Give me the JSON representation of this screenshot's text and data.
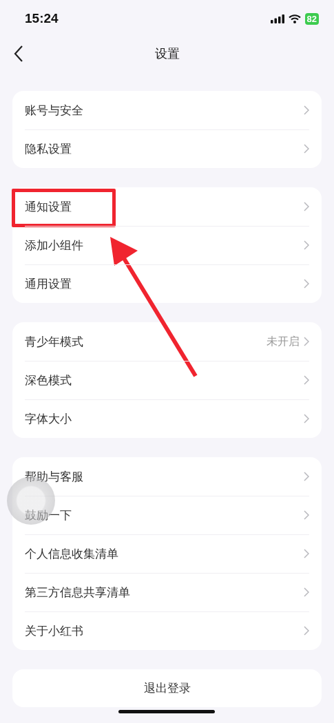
{
  "status_bar": {
    "time": "15:24",
    "battery": "82"
  },
  "nav": {
    "title": "设置"
  },
  "groups": [
    {
      "items": [
        {
          "label": "账号与安全",
          "highlighted": false
        },
        {
          "label": "隐私设置",
          "highlighted": false
        }
      ]
    },
    {
      "items": [
        {
          "label": "通知设置",
          "highlighted": true
        },
        {
          "label": "添加小组件",
          "highlighted": false
        },
        {
          "label": "通用设置",
          "highlighted": false
        }
      ]
    },
    {
      "items": [
        {
          "label": "青少年模式",
          "value": "未开启",
          "highlighted": false
        },
        {
          "label": "深色模式",
          "highlighted": false
        },
        {
          "label": "字体大小",
          "highlighted": false
        }
      ]
    },
    {
      "items": [
        {
          "label": "帮助与客服",
          "highlighted": false
        },
        {
          "label": "鼓励一下",
          "highlighted": false
        },
        {
          "label": "个人信息收集清单",
          "highlighted": false
        },
        {
          "label": "第三方信息共享清单",
          "highlighted": false
        },
        {
          "label": "关于小红书",
          "highlighted": false
        }
      ]
    }
  ],
  "logout": "退出登录"
}
